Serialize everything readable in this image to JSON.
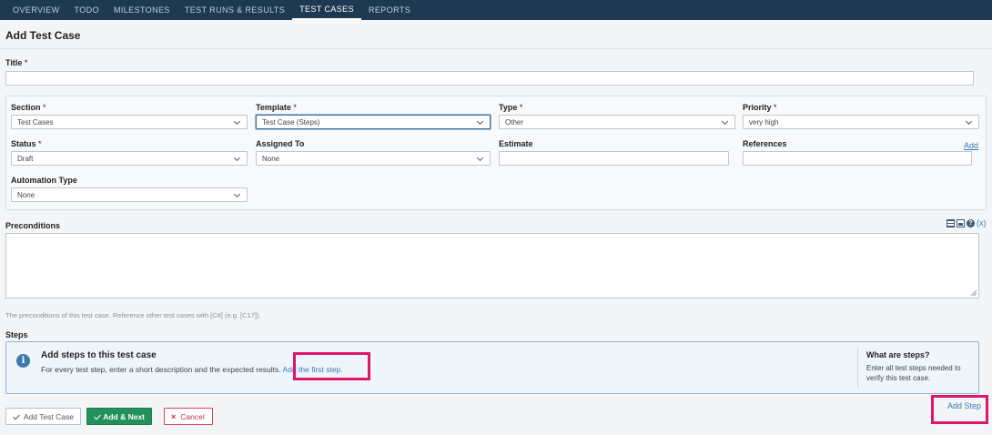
{
  "nav": {
    "tabs": [
      "OVERVIEW",
      "TODO",
      "MILESTONES",
      "TEST RUNS & RESULTS",
      "TEST CASES",
      "REPORTS"
    ],
    "active": "TEST CASES"
  },
  "page": {
    "title": "Add Test Case"
  },
  "title_field": {
    "label": "Title",
    "required": "*",
    "value": ""
  },
  "fields": {
    "section": {
      "label": "Section",
      "required": "*",
      "value": "Test Cases"
    },
    "template": {
      "label": "Template",
      "required": "*",
      "value": "Test Case (Steps)"
    },
    "type": {
      "label": "Type",
      "required": "*",
      "value": "Other"
    },
    "priority": {
      "label": "Priority",
      "required": "*",
      "value": "very high"
    },
    "status": {
      "label": "Status",
      "required": "*",
      "value": "Draft"
    },
    "assigned_to": {
      "label": "Assigned To",
      "value": "None"
    },
    "estimate": {
      "label": "Estimate",
      "value": ""
    },
    "references": {
      "label": "References",
      "value": "",
      "add_link": "Add"
    },
    "automation_type": {
      "label": "Automation Type",
      "value": "None"
    }
  },
  "preconditions": {
    "label": "Preconditions",
    "value": "",
    "hint": "The preconditions of this test case. Reference other test cases with [C#] (e.g. [C17]).",
    "toolbar_icons": [
      "table-icon",
      "image-icon",
      "help-icon",
      "variable-icon"
    ],
    "variable_glyph": "(x)",
    "help_glyph": "?"
  },
  "steps": {
    "label": "Steps",
    "info_title": "Add steps to this test case",
    "info_desc": "For every test step, enter a short description and the expected results.",
    "add_first_link": "Add the first step.",
    "what_title": "What are steps?",
    "what_desc": "Enter all test steps needed to verify this test case.",
    "add_step_link": "Add Step"
  },
  "buttons": {
    "add_test_case": "Add Test Case",
    "add_next": "Add & Next",
    "cancel": "Cancel"
  },
  "colors": {
    "nav_bg": "#1d3a52",
    "link": "#3a7ab8",
    "primary_button": "#23915a",
    "cancel": "#c92f45",
    "highlight": "#e0156b"
  }
}
